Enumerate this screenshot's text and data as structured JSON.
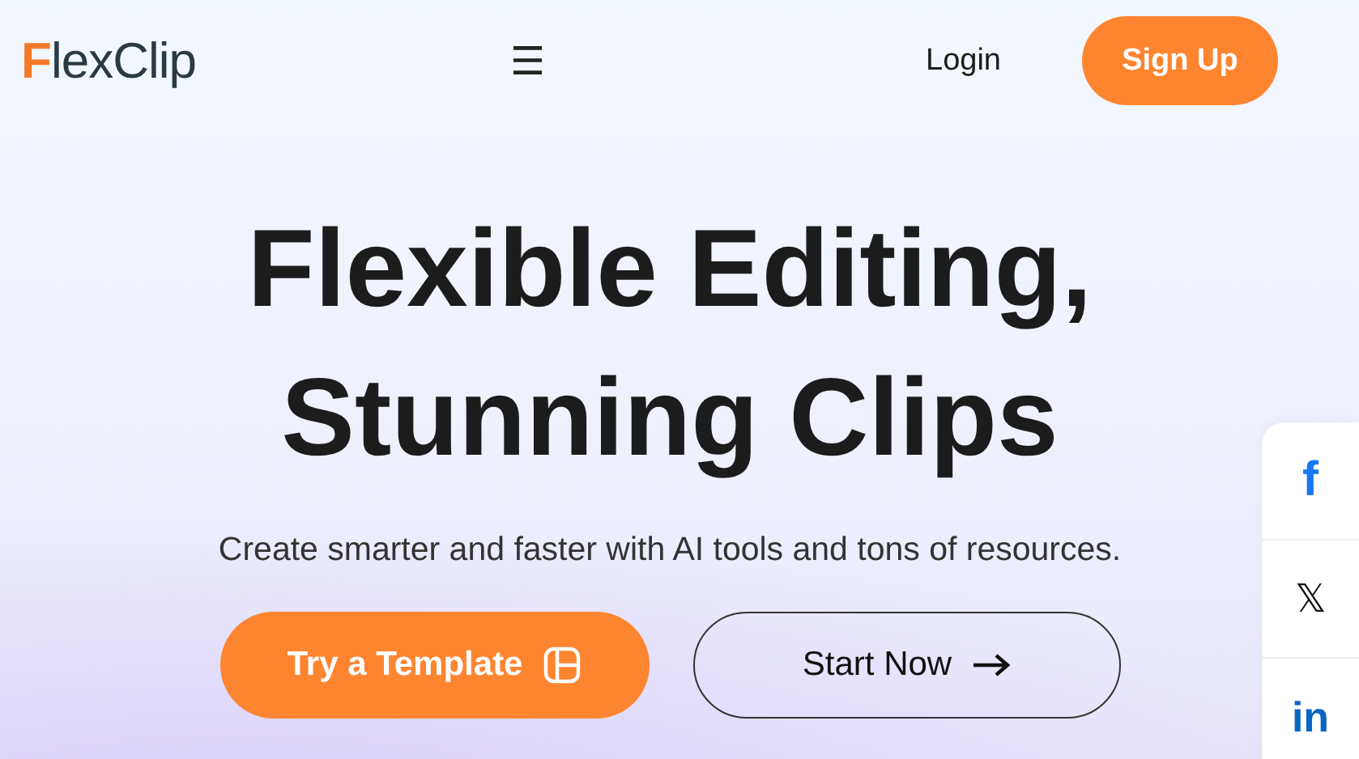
{
  "header": {
    "logo": "FlexClip",
    "menu_icon": "☰",
    "login": "Login",
    "signup": "Sign Up"
  },
  "hero": {
    "title_lines": [
      "Flexible Editing,",
      "Stunning Clips"
    ],
    "subtitle": "Create smarter and faster with AI tools and tons of resources.",
    "buttons": [
      {
        "label": "Try a Template",
        "kind": "primary"
      },
      {
        "label": "Start Now",
        "kind": "outline"
      }
    ]
  },
  "social": [
    {
      "label": "f",
      "kind": "facebook"
    },
    {
      "label": "𝕏",
      "kind": "x"
    },
    {
      "label": "in",
      "kind": "linkedin"
    }
  ]
}
